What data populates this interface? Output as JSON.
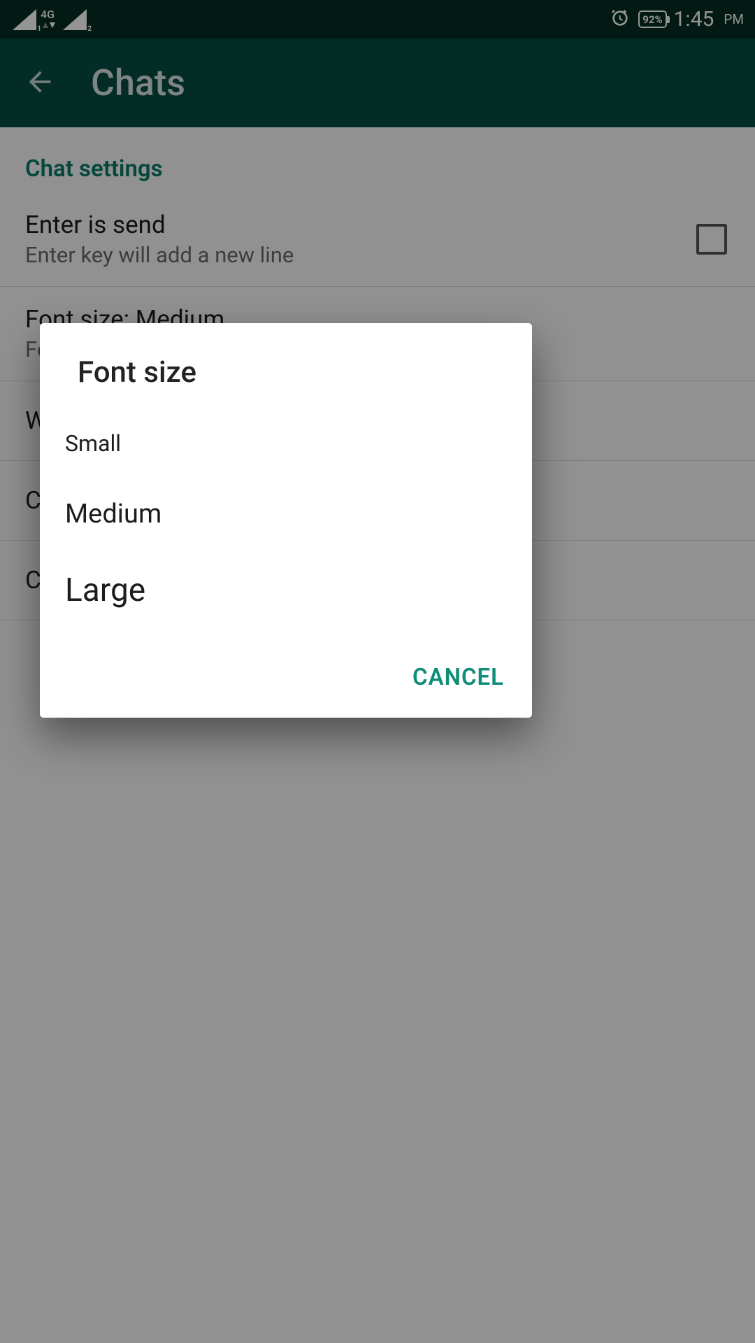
{
  "status": {
    "sim1_index": "1",
    "net_label": "4G",
    "sim2_index": "2",
    "battery_pct": "92%",
    "time": "1:45",
    "ampm": "PM"
  },
  "header": {
    "title": "Chats"
  },
  "settings": {
    "section_label": "Chat settings",
    "enter_send": {
      "title": "Enter is send",
      "subtitle": "Enter key will add a new line"
    },
    "font_size_row": {
      "title": "Font size: Medium",
      "subtitle": "Font size"
    },
    "rows": {
      "r1": "W",
      "r2": "C",
      "r3": "C"
    }
  },
  "dialog": {
    "title": "Font size",
    "options": {
      "small": "Small",
      "medium": "Medium",
      "large": "Large"
    },
    "cancel": "CANCEL"
  },
  "colors": {
    "accent": "#0f8d78",
    "header_bg": "#054d40"
  }
}
